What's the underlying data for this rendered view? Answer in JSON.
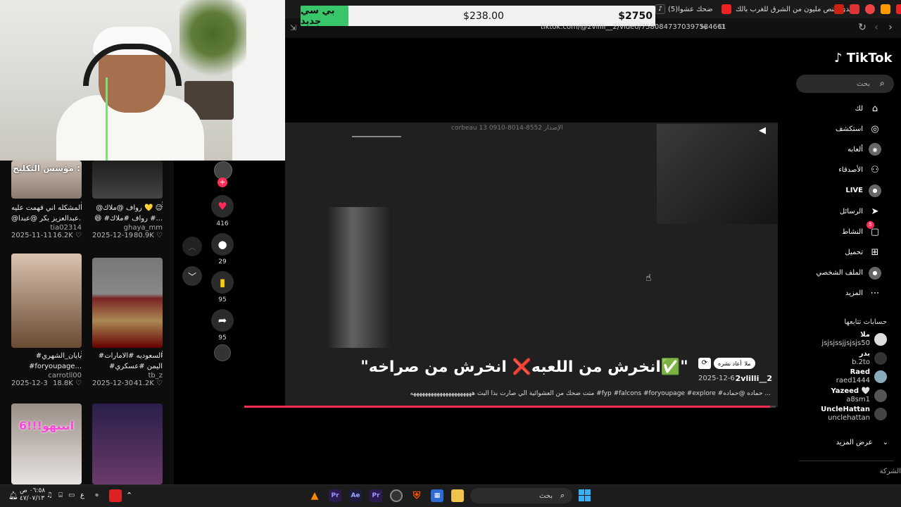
{
  "browser": {
    "url": "tiktok.com/@2vlilli__2/video/7580847370397584661",
    "tabs": [
      "تحدي النص مليون من الشرق للغرب بالك",
      "(5)ضحك عشوا"
    ]
  },
  "overlay": {
    "badge": "بي سي جديد",
    "low_bid": "$238.00",
    "high_bid": "$2750"
  },
  "left_grid": {
    "items": [
      {
        "thumb_text": "مؤسس التكليح :",
        "title1": "المشكله اني فهمت عليه",
        "title2": "@عبدالعزيز بكر @عبدا...",
        "author": "tia02314",
        "date": "2025-11-11",
        "likes": "16.2K"
      },
      {
        "thumb_text": "",
        "title1": "@رواف @ملاك 💛 😉",
        "title2": "😄 #رواف #ملاك #...",
        "author": "ghaya_mm",
        "date": "2025-12-19",
        "likes": "80.9K"
      },
      {
        "thumb_text": "",
        "title1": "#بايان_الشهري",
        "title2": "#foryoupage...",
        "author": "carrotll00",
        "date": "2025-12-3",
        "likes": "18.8K"
      },
      {
        "thumb_text": "",
        "title1": "#السعوديه #الامارات",
        "title2": "#اليمن #عسكري",
        "author": "tb_z",
        "date": "2025-12-30",
        "likes": "41.2K"
      },
      {
        "thumb_text": "انتبهو!!!6",
        "title1": "",
        "title2": "",
        "author": "",
        "date": "",
        "likes": ""
      },
      {
        "thumb_text": "",
        "title1": "",
        "title2": "",
        "author": "",
        "date": "",
        "likes": ""
      }
    ]
  },
  "actions": {
    "likes": "416",
    "comments": "29",
    "bookmarks": "95",
    "shares": "95"
  },
  "video": {
    "watermark": "corbeau  13 الإصدار 8552-8014-0910",
    "caption": "\"انخرش من اللعبه❌ انخرش من صراخه✅\"",
    "username": "2vlilli__2",
    "date": "2025-12-6",
    "repost_label": "أعاد نشره",
    "repost_user": "ملا",
    "description": "متت ضحك من العشوائية الي صارت بذا البث هههههههههههههههههههههه #fyp #falcons #foryoupage #explore #حماده @حماده ...",
    "progress_fraction": 0.99
  },
  "sidebar": {
    "logo": "TikTok",
    "search_placeholder": "بحث",
    "items": [
      {
        "label": "لك",
        "icon": "home-icon"
      },
      {
        "label": "استكشف",
        "icon": "compass-icon"
      },
      {
        "label": "ألعابه",
        "icon": "game-icon"
      },
      {
        "label": "الأصدقاء",
        "icon": "friends-icon"
      },
      {
        "label": "LIVE",
        "icon": "live-icon"
      },
      {
        "label": "الرسائل",
        "icon": "send-icon"
      },
      {
        "label": "النشاط",
        "icon": "activity-icon"
      },
      {
        "label": "تحميل",
        "icon": "upload-icon"
      },
      {
        "label": "الملف الشخصي",
        "icon": "profile-icon"
      },
      {
        "label": "المزيد",
        "icon": "more-icon"
      }
    ],
    "activity_badge": "5",
    "following_header": "حسابات تتابعها",
    "accounts": [
      {
        "name": "ملا",
        "user": "jsjsjssjjsjsjs50"
      },
      {
        "name": "بدر",
        "user": "b.2to"
      },
      {
        "name": "Raed",
        "user": "raed1444"
      },
      {
        "name": "Yazeed 🤍",
        "user": "a8sm1"
      },
      {
        "name": "UncleHattan",
        "user": "unclehattan"
      }
    ],
    "show_more": "عرض المزيد",
    "company": "الشركة"
  },
  "taskbar": {
    "search": "بحث",
    "time": "٠٦:٥٨ ص",
    "date": "٤٧/٠٧/١٣",
    "lang": "ع"
  }
}
